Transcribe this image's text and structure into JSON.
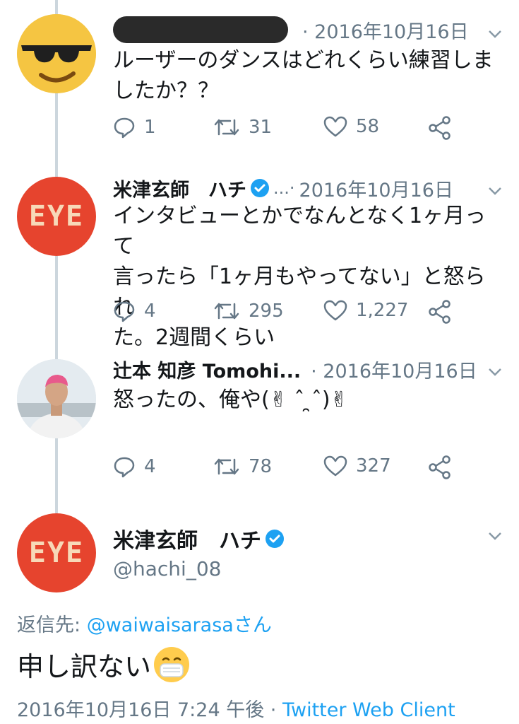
{
  "colors": {
    "accent": "#1da1f2",
    "muted": "#657786",
    "text": "#14171a",
    "eye_bg": "#e6442e"
  },
  "tweets": [
    {
      "display_name": "",
      "date": "· 2016年10月16日",
      "text_lines": [
        "ルーザーのダンスはどれくらい練習しま",
        "したか？？"
      ],
      "reply_count": "1",
      "retweet_count": "31",
      "like_count": "58",
      "avatar_icon": "sunglasses-emoji-icon"
    },
    {
      "display_name": "米津玄師　ハチ",
      "ellipsis": "...·",
      "date": "2016年10月16日",
      "text_lines": [
        "インタビューとかでなんとなく1ヶ月って",
        "言ったら「1ヶ月もやってない」と怒られ",
        "た。2週間くらい"
      ],
      "reply_count": "4",
      "retweet_count": "295",
      "like_count": "1,227",
      "avatar_text": "EYE"
    },
    {
      "display_name": "辻本 知彦 Tomohi...",
      "date": "· 2016年10月16日",
      "text_lines": [
        "怒ったの、俺や(✌︎ ˆ ̯ˆ)✌︎"
      ],
      "reply_count": "4",
      "retweet_count": "78",
      "like_count": "327",
      "avatar_icon": "pink-hair-person-photo"
    }
  ],
  "main_tweet": {
    "display_name": "米津玄師　ハチ",
    "handle": "@hachi_08",
    "avatar_text": "EYE",
    "reply_to_label": "返信先: ",
    "reply_to_user": "@waiwaisarasa",
    "reply_to_suffix": "さん",
    "text": "申し訳ない",
    "emoji": "mask-face-emoji",
    "timestamp": "2016年10月16日 7:24 午後 · ",
    "client": "Twitter Web Client"
  }
}
